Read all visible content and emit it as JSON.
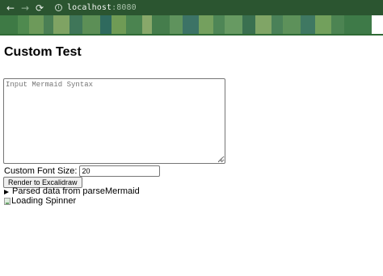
{
  "browser": {
    "url_host": "localhost",
    "url_port": ":8080",
    "icons": {
      "back": "arrow-left-icon",
      "forward": "arrow-right-icon",
      "reload": "reload-icon",
      "info": "info-icon"
    },
    "colors": {
      "toolbar": "#2b5530"
    }
  },
  "page": {
    "title": "Custom Test",
    "mermaid_input": {
      "value": "",
      "placeholder": "Input Mermaid Syntax"
    },
    "font_size": {
      "label": "Custom Font Size:",
      "value": "20"
    },
    "render_button": "Render to Excalidraw",
    "parsed_details": {
      "summary": "Parsed data from parseMermaid",
      "open": false
    },
    "spinner_image": {
      "alt": "Loading Spinner"
    }
  }
}
